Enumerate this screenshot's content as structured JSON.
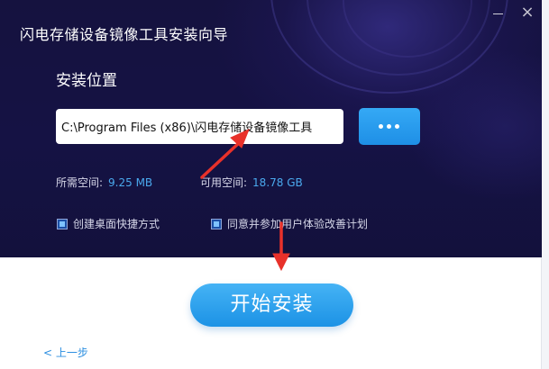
{
  "window": {
    "title": "闪电存储设备镜像工具安装向导",
    "minimize_icon": "minimize-icon",
    "close_icon": "close-icon",
    "close_glyph": "×"
  },
  "install": {
    "section_label": "安装位置",
    "path_value": "C:\\Program Files (x86)\\闪电存储设备镜像工具",
    "browse_icon": "ellipsis-icon"
  },
  "space": {
    "required_label": "所需空间:",
    "required_value": "9.25 MB",
    "available_label": "可用空间:",
    "available_value": "18.78 GB"
  },
  "options": [
    {
      "label": "创建桌面快捷方式",
      "checked": true
    },
    {
      "label": "同意并参加用户体验改善计划",
      "checked": true
    }
  ],
  "actions": {
    "start_label": "开始安装",
    "back_label": "< 上一步"
  },
  "colors": {
    "panel_bg": "#15123f",
    "accent_blue": "#1e8fe6",
    "value_blue": "#4aa9ee",
    "arrow_red": "#e8312a"
  }
}
